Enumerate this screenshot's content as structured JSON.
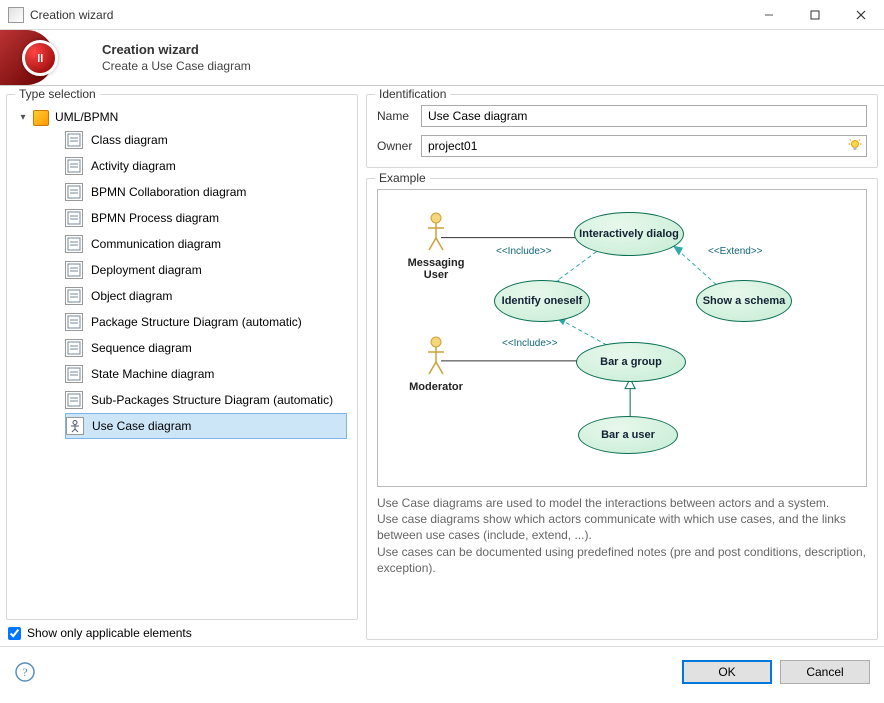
{
  "window": {
    "title": "Creation wizard"
  },
  "header": {
    "title": "Creation wizard",
    "subtitle": "Create a Use Case diagram"
  },
  "leftPanel": {
    "legend": "Type selection",
    "treeRoot": "UML/BPMN",
    "items": [
      {
        "label": "Class diagram"
      },
      {
        "label": "Activity diagram"
      },
      {
        "label": "BPMN Collaboration diagram"
      },
      {
        "label": "BPMN Process diagram"
      },
      {
        "label": "Communication diagram"
      },
      {
        "label": "Deployment diagram"
      },
      {
        "label": "Object diagram"
      },
      {
        "label": "Package Structure Diagram (automatic)"
      },
      {
        "label": "Sequence diagram"
      },
      {
        "label": "State Machine diagram"
      },
      {
        "label": "Sub-Packages Structure Diagram (automatic)"
      },
      {
        "label": "Use Case diagram"
      }
    ],
    "selectedIndex": 11,
    "showOnlyApplicable": "Show only applicable elements"
  },
  "identification": {
    "legend": "Identification",
    "nameLabel": "Name",
    "nameValue": "Use Case diagram",
    "ownerLabel": "Owner",
    "ownerValue": "project01"
  },
  "example": {
    "legend": "Example",
    "actors": {
      "messagingUser": "Messaging User",
      "moderator": "Moderator"
    },
    "usecases": {
      "interactivelyDialog": "Interactively dialog",
      "identifyOneself": "Identify oneself",
      "showSchema": "Show a schema",
      "barGroup": "Bar a group",
      "barUser": "Bar a user"
    },
    "relLabels": {
      "include1": "<<Include>>",
      "include2": "<<Include>>",
      "extend": "<<Extend>>"
    },
    "description": "Use Case diagrams are used to model the interactions between actors and a system.\nUse case diagrams show which actors communicate with which use cases, and the links between use cases (include, extend, ...).\nUse cases can be documented using predefined notes (pre and post conditions, description, exception)."
  },
  "footer": {
    "ok": "OK",
    "cancel": "Cancel"
  }
}
